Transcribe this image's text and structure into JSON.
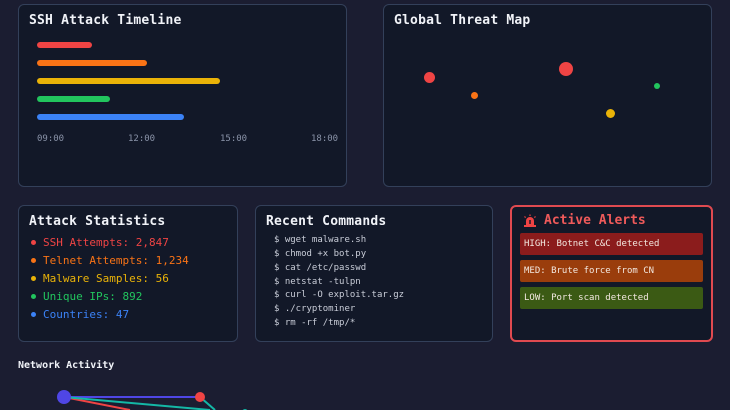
{
  "timeline": {
    "title": "SSH Attack Timeline",
    "ticks": [
      "09:00",
      "12:00",
      "15:00",
      "18:00"
    ],
    "bars": [
      {
        "color": "#ef4444"
      },
      {
        "color": "#f97316"
      },
      {
        "color": "#eab308"
      },
      {
        "color": "#22c55e"
      },
      {
        "color": "#3b82f6"
      }
    ]
  },
  "map": {
    "title": "Global Threat Map",
    "points": [
      {
        "color": "#ef4444"
      },
      {
        "color": "#f97316"
      },
      {
        "color": "#ef4444"
      },
      {
        "color": "#eab308"
      },
      {
        "color": "#22c55e"
      }
    ]
  },
  "stats": {
    "title": "Attack Statistics",
    "items": [
      {
        "label": "SSH Attempts: 2,847",
        "color": "#ef4444"
      },
      {
        "label": "Telnet Attempts: 1,234",
        "color": "#f97316"
      },
      {
        "label": "Malware Samples: 56",
        "color": "#eab308"
      },
      {
        "label": "Unique IPs: 892",
        "color": "#22c55e"
      },
      {
        "label": "Countries: 47",
        "color": "#3b82f6"
      }
    ]
  },
  "commands": {
    "title": "Recent Commands",
    "items": [
      "$ wget malware.sh",
      "$ chmod +x bot.py",
      "$ cat /etc/passwd",
      "$ netstat -tulpn",
      "$ curl -O exploit.tar.gz",
      "$ ./cryptominer",
      "$ rm -rf /tmp/*"
    ]
  },
  "alerts": {
    "title": "Active Alerts",
    "icon": "siren-icon",
    "accent": "#ef5a5a",
    "items": [
      {
        "text": "HIGH: Botnet C&C detected",
        "bg": "#8b1c1c"
      },
      {
        "text": "MED: Brute force from CN",
        "bg": "#9a3d0c"
      },
      {
        "text": "LOW: Port scan detected",
        "bg": "#3b5a14"
      }
    ]
  },
  "network": {
    "title": "Network Activity",
    "node_colors": [
      "#4f46e5",
      "#ef4444",
      "#14b8a6"
    ]
  }
}
